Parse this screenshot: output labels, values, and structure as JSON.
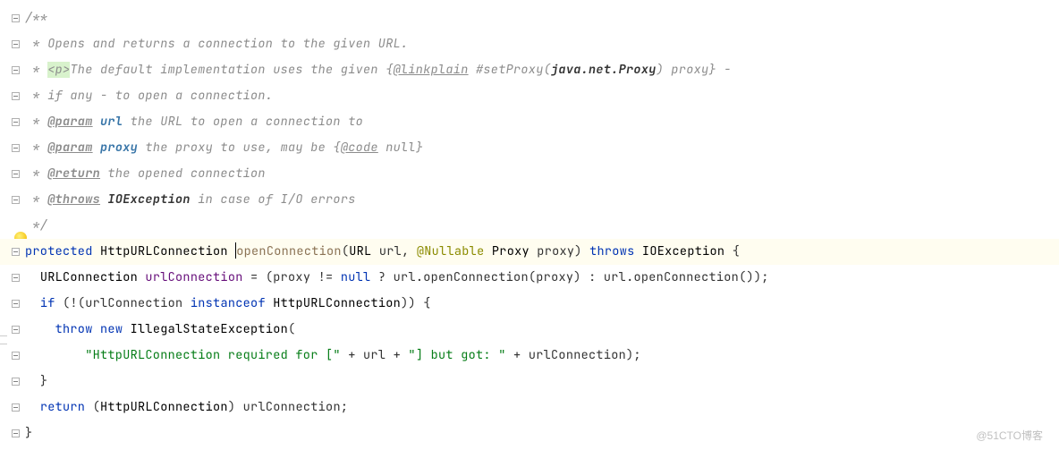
{
  "line1": {
    "c1": " * Opens and returns a connection to the given URL."
  },
  "line2": {
    "c1": " * ",
    "p": "<p>",
    "c2": "The default implementation uses the given {",
    "tag": "@linkplain",
    "c3": " #setProxy(",
    "ref": "java.net.Proxy",
    "c4": ") proxy} -"
  },
  "line3": {
    "c1": " * if any - to open a connection."
  },
  "line4": {
    "c1": " * ",
    "tag": "@param",
    "c2": " ",
    "name": "url",
    "c3": " the URL to open a connection to"
  },
  "line5": {
    "c1": " * ",
    "tag": "@param",
    "c2": " ",
    "name": "proxy",
    "c3": " the proxy to use, may be {",
    "code": "@code",
    "c4": " null}"
  },
  "line6": {
    "c1": " * ",
    "tag": "@return",
    "c2": " the opened connection"
  },
  "line7": {
    "c1": " * ",
    "tag": "@throws",
    "c2": " ",
    "ex": "IOException",
    "c3": " in case of I/O errors"
  },
  "line8": {
    "c1": " */"
  },
  "line9": {
    "kw1": "protected",
    "sp": " ",
    "t1": "HttpURLConnection",
    "sp2": " ",
    "m": "openConnection",
    "p1": "(",
    "t2": "URL",
    "sp3": " ",
    "a1": "url",
    "c1": ", ",
    "ann": "@Nullable",
    "sp4": " ",
    "t3": "Proxy",
    "sp5": " ",
    "a2": "proxy",
    "p2": ") ",
    "kw2": "throws",
    "sp6": " ",
    "t4": "IOException",
    "b": " {"
  },
  "line10": {
    "ind": "  ",
    "t1": "URLConnection",
    "sp": " ",
    "v": "urlConnection",
    "eq": " = (",
    "v2": "proxy",
    "c1": " != ",
    "kw": "null",
    "c2": " ? ",
    "v3": "url",
    "c3": ".openConnection(",
    "v4": "proxy",
    "c4": ") : ",
    "v5": "url",
    "c5": ".openConnection());"
  },
  "line11": {
    "ind": "  ",
    "kw": "if",
    "c1": " (!(",
    "v": "urlConnection",
    "sp": " ",
    "kw2": "instanceof",
    "sp2": " ",
    "t": "HttpURLConnection",
    "c2": ")) {"
  },
  "line12": {
    "ind": "    ",
    "kw": "throw",
    "sp": " ",
    "kw2": "new",
    "sp2": " ",
    "t": "IllegalStateException",
    "c": "("
  },
  "line13": {
    "ind": "        ",
    "s1": "\"HttpURLConnection required for [\"",
    "c1": " + ",
    "v1": "url",
    "c2": " + ",
    "s2": "\"] but got: \"",
    "c3": " + ",
    "v2": "urlConnection",
    "c4": ");"
  },
  "line14": {
    "ind": "  ",
    "c": "}"
  },
  "line15": {
    "ind": "  ",
    "kw": "return",
    "c1": " (",
    "t": "HttpURLConnection",
    "c2": ") ",
    "v": "urlConnection",
    "c3": ";"
  },
  "line16": {
    "c": "}"
  },
  "comment_start": "/**",
  "watermark": "@51CTO博客"
}
